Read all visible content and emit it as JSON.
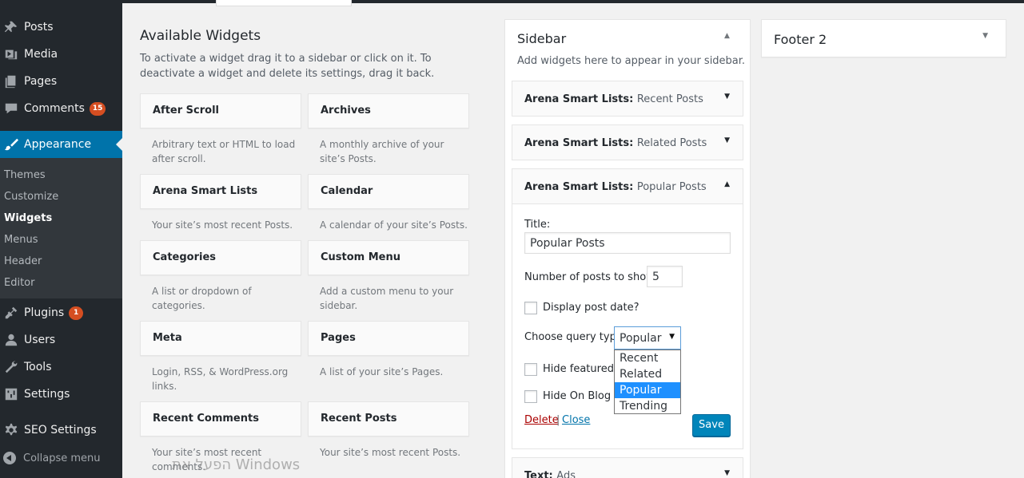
{
  "menu": {
    "posts": "Posts",
    "media": "Media",
    "pages": "Pages",
    "comments": "Comments",
    "comments_badge": "15",
    "appearance": "Appearance",
    "submenu": [
      "Themes",
      "Customize",
      "Widgets",
      "Menus",
      "Header",
      "Editor"
    ],
    "plugins": "Plugins",
    "plugins_badge": "1",
    "users": "Users",
    "tools": "Tools",
    "settings": "Settings",
    "seo": "SEO Settings",
    "collapse": "Collapse menu"
  },
  "available": {
    "title": "Available Widgets",
    "description": "To activate a widget drag it to a sidebar or click on it. To deactivate a widget and delete its settings, drag it back.",
    "widgets": [
      {
        "name": "After Scroll",
        "desc": "Arbitrary text or HTML to load after scroll."
      },
      {
        "name": "Archives",
        "desc": "A monthly archive of your site’s Posts."
      },
      {
        "name": "Arena Smart Lists",
        "desc": "Your site’s most recent Posts."
      },
      {
        "name": "Calendar",
        "desc": "A calendar of your site’s Posts."
      },
      {
        "name": "Categories",
        "desc": "A list or dropdown of categories."
      },
      {
        "name": "Custom Menu",
        "desc": "Add a custom menu to your sidebar."
      },
      {
        "name": "Meta",
        "desc": "Login, RSS, & WordPress.org links."
      },
      {
        "name": "Pages",
        "desc": "A list of your site’s Pages."
      },
      {
        "name": "Recent Comments",
        "desc": "Your site’s most recent comments."
      },
      {
        "name": "Recent Posts",
        "desc": "Your site’s most recent Posts."
      }
    ]
  },
  "sidebar": {
    "title": "Sidebar",
    "description": "Add widgets here to appear in your sidebar.",
    "widgets": [
      {
        "prefix": "Arena Smart Lists:",
        "name": "Recent Posts"
      },
      {
        "prefix": "Arena Smart Lists:",
        "name": "Related Posts"
      },
      {
        "prefix": "Arena Smart Lists:",
        "name": "Popular Posts"
      },
      {
        "prefix": "Text:",
        "name": "Ads"
      }
    ],
    "form": {
      "title_label": "Title:",
      "title_value": "Popular Posts",
      "num_label": "Number of posts to show:",
      "num_value": "5",
      "display_date_label": "Display post date?",
      "query_label": "Choose query type",
      "query_selected": "Popular",
      "query_options": [
        "Recent",
        "Related",
        "Popular",
        "Trending"
      ],
      "hide_featured_label": "Hide featured i",
      "hide_on_blog_label": "Hide On Blog p",
      "delete": "Delete",
      "separator": "|",
      "close": "Close",
      "save": "Save"
    }
  },
  "footer2": {
    "title": "Footer 2"
  },
  "watermark": "Windows הפעל את"
}
